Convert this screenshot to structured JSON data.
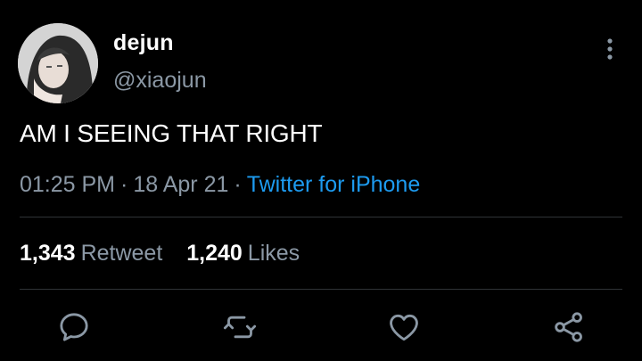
{
  "user": {
    "display_name": "dejun",
    "handle": "@xiaojun"
  },
  "tweet": {
    "text": "AM I SEEING THAT RIGHT",
    "time": "01:25 PM",
    "separator": "·",
    "date": "18 Apr 21",
    "source": "Twitter for iPhone"
  },
  "stats": {
    "retweets_count": "1,343",
    "retweets_label": "Retweet",
    "likes_count": "1,240",
    "likes_label": "Likes"
  },
  "icons": {
    "more": "more-vertical-icon",
    "reply": "reply-icon",
    "retweet": "retweet-icon",
    "like": "heart-icon",
    "share": "share-icon"
  },
  "colors": {
    "background": "#000000",
    "primary_text": "#ffffff",
    "secondary_text": "#8b98a5",
    "link": "#1d9bf0",
    "divider": "#2f3336"
  }
}
